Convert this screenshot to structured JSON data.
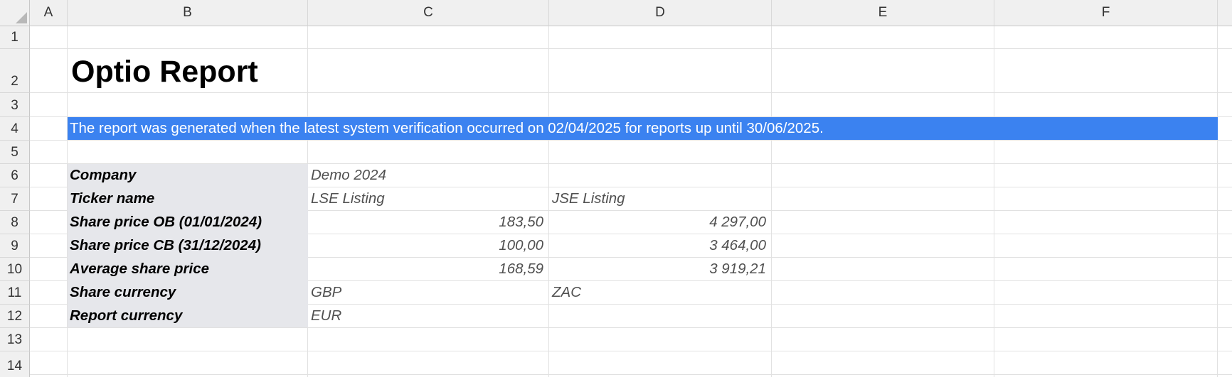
{
  "columns": [
    "A",
    "B",
    "C",
    "D",
    "E",
    "F"
  ],
  "rows": [
    "1",
    "2",
    "3",
    "4",
    "5",
    "6",
    "7",
    "8",
    "9",
    "10",
    "11",
    "12",
    "13",
    "14"
  ],
  "report": {
    "title": "Optio Report",
    "banner": "The report was generated when the latest system verification occurred on 02/04/2025 for reports up until 30/06/2025.",
    "banner_color": "#3b82f0",
    "label_fill": "#e6e7eb"
  },
  "table": [
    {
      "label": "Company",
      "c": "Demo 2024",
      "d": ""
    },
    {
      "label": "Ticker name",
      "c": "LSE Listing",
      "d": "JSE Listing"
    },
    {
      "label": "Share price OB (01/01/2024)",
      "c": "183,50",
      "d": "4 297,00"
    },
    {
      "label": "Share price CB (31/12/2024)",
      "c": "100,00",
      "d": "3 464,00"
    },
    {
      "label": "Average share price",
      "c": "168,59",
      "d": "3 919,21"
    },
    {
      "label": "Share currency",
      "c": "GBP",
      "d": "ZAC"
    },
    {
      "label": "Report currency",
      "c": "EUR",
      "d": ""
    }
  ]
}
